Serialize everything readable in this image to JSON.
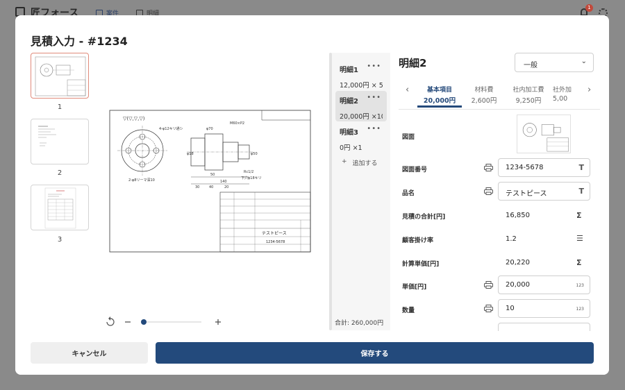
{
  "app": {
    "brand": "匠フォース",
    "nav": [
      {
        "label": "案件",
        "icon": "folder-icon"
      },
      {
        "label": "明細",
        "icon": "document-icon"
      }
    ],
    "notification_count": "1"
  },
  "modal": {
    "title": "見積入力 - #1234",
    "thumbnails": [
      {
        "page": "1"
      },
      {
        "page": "2"
      },
      {
        "page": "3"
      }
    ],
    "line_items": [
      {
        "name": "明細1",
        "amount": "12,000円 × 5"
      },
      {
        "name": "明細2",
        "amount": "20,000円 ×10"
      },
      {
        "name": "明細3",
        "amount": "0円 ×1"
      }
    ],
    "more_label": "•••",
    "add_label": "追加する",
    "total_label": "合計: 260,000円",
    "detail": {
      "title": "明細2",
      "category_select": "一般",
      "tabs": [
        {
          "label": "基本項目",
          "value": "20,000円"
        },
        {
          "label": "材料費",
          "value": "2,600円"
        },
        {
          "label": "社内加工費",
          "value": "9,250円"
        },
        {
          "label": "社外加",
          "value": "5,00"
        }
      ],
      "fields": {
        "drawing_label": "図面",
        "drawing_number_label": "図面番号",
        "drawing_number": "1234-5678",
        "part_name_label": "品名",
        "part_name": "テストピース",
        "estimate_total_label": "見積の合計[円]",
        "estimate_total": "16,850",
        "customer_rate_label": "顧客掛け率",
        "customer_rate": "1.2",
        "calc_unit_price_label": "計算単価[円]",
        "calc_unit_price": "20,220",
        "unit_price_label": "単価[円]",
        "unit_price": "20,000",
        "quantity_label": "数量",
        "quantity": "10",
        "number_suffix": "123"
      }
    },
    "drawing": {
      "title_block_name": "テストピース",
      "title_block_number": "1234-5678",
      "dims": [
        "140",
        "50",
        "30",
        "40",
        "20",
        "8",
        "8",
        "φ70",
        "φ18",
        "φ50",
        "M60×P2",
        "Rc1/2",
        "4-φ12キリ通シ",
        "2-φ8リーマ深10",
        "下穴φ18キリ"
      ]
    },
    "cancel_label": "キャンセル",
    "save_label": "保存する",
    "colors": {
      "primary": "#234a7c",
      "selected_thumb": "#e08a7a"
    }
  }
}
